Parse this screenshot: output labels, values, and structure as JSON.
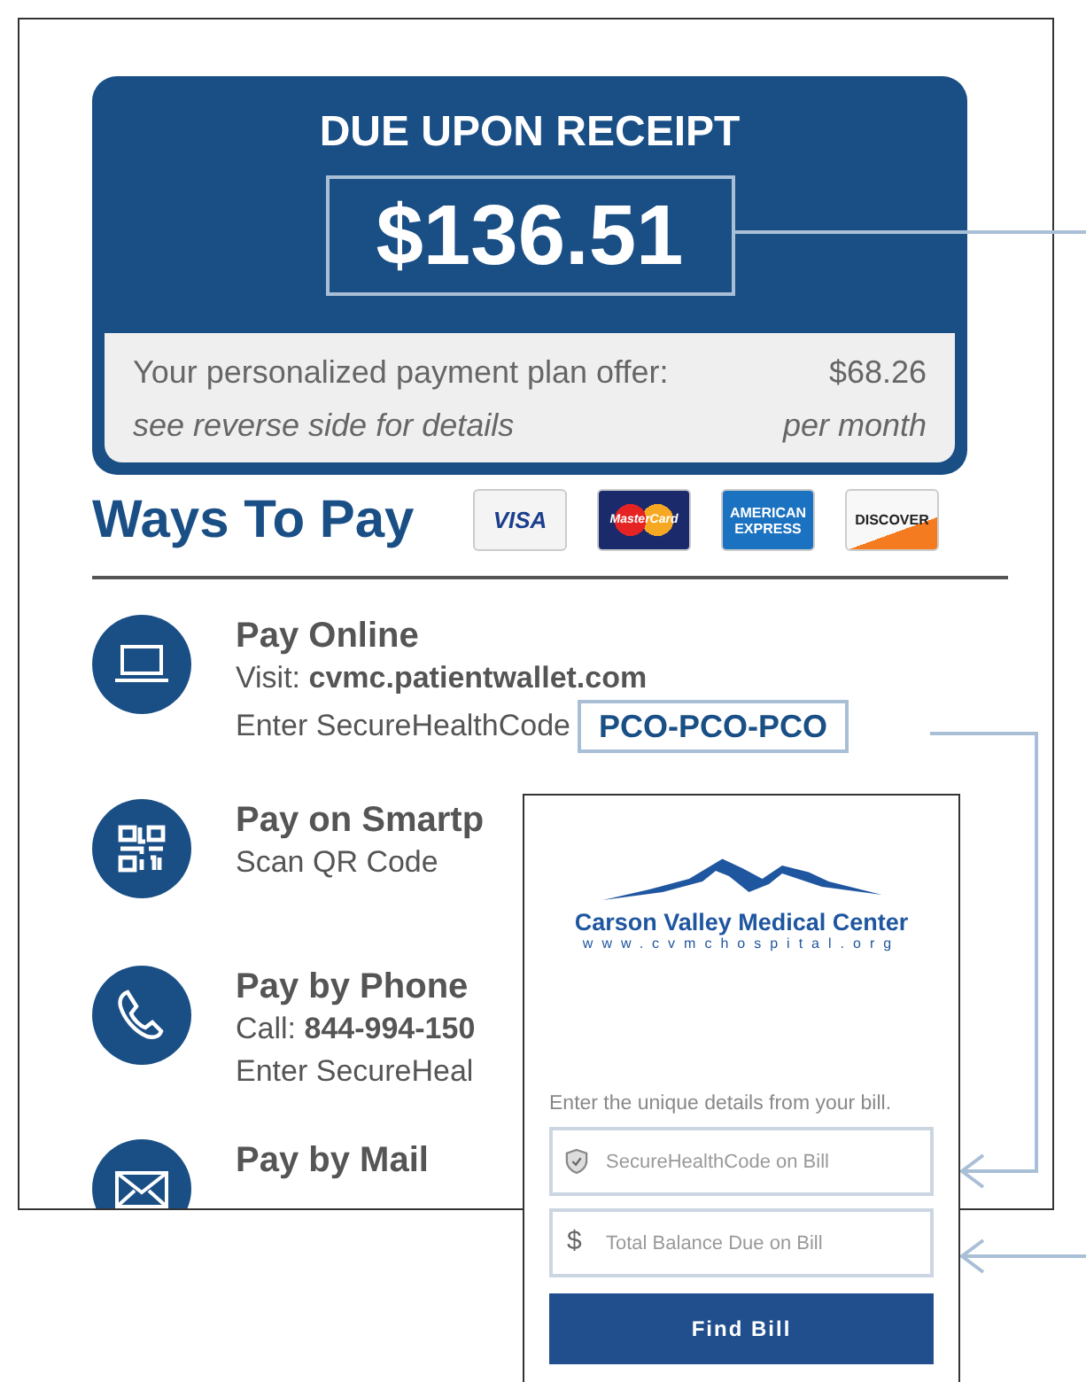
{
  "due": {
    "title": "DUE UPON RECEIPT",
    "amount": "$136.51",
    "offer_label": "Your personalized payment plan offer:",
    "offer_amount": "$68.26",
    "offer_note": "see reverse side for details",
    "offer_period": "per month"
  },
  "ways_to_pay": {
    "title": "Ways To Pay",
    "cards": [
      {
        "kind": "visa",
        "label": "VISA"
      },
      {
        "kind": "mastercard",
        "label": "MasterCard"
      },
      {
        "kind": "amex",
        "label": "AMERICAN EXPRESS"
      },
      {
        "kind": "discover",
        "label": "DISCOVER"
      }
    ]
  },
  "methods": [
    {
      "kind": "online",
      "title": "Pay Online",
      "lines": [
        "Visit: **cvmc.patientwallet.com**",
        "Enter SecureHealthCode"
      ],
      "code": "PCO-PCO-PCO"
    },
    {
      "kind": "qr",
      "title": "Pay on Smartp",
      "lines": [
        "Scan QR Code"
      ]
    },
    {
      "kind": "phone",
      "title": "Pay by Phone",
      "lines": [
        "Call: **844-994-150**",
        "Enter SecureHeal"
      ]
    },
    {
      "kind": "mail",
      "title": "Pay by Mail"
    }
  ],
  "phone_screen": {
    "logo_name": "Carson Valley Medical Center",
    "logo_url": "www.cvmchospital.org",
    "prompt": "Enter the unique details from your bill.",
    "fields": [
      {
        "kind": "shield",
        "placeholder": "SecureHealthCode on Bill"
      },
      {
        "kind": "dollar",
        "symbol": "$",
        "placeholder": "Total Balance Due on Bill"
      }
    ],
    "button": "Find Bill"
  }
}
